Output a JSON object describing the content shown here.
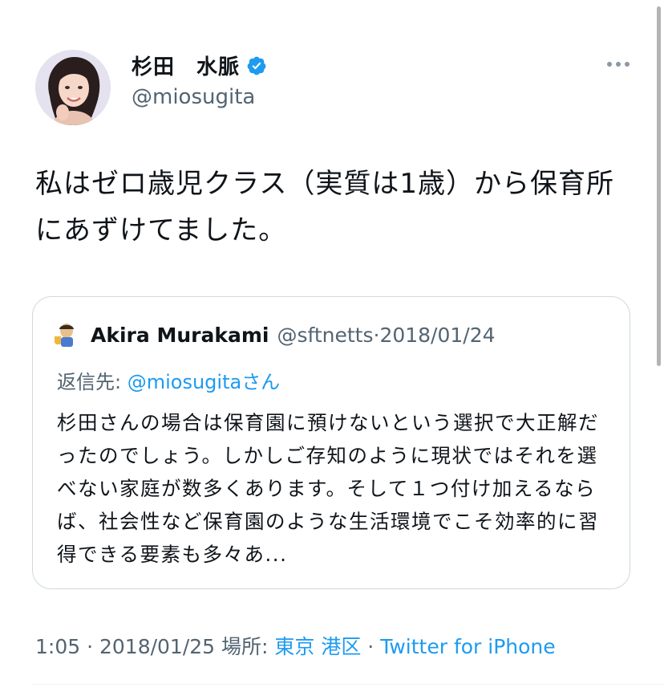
{
  "author": {
    "name": "杉田　水脈",
    "handle": "@miosugita",
    "verified": true
  },
  "tweet": {
    "text": "私はゼロ歳児クラス（実質は1歳）から保育所にあずけてました。"
  },
  "quoted_tweet": {
    "author_name": "Akira Murakami",
    "author_handle": "@sftnetts",
    "separator": " · ",
    "date": "2018/01/24",
    "reply_prefix": "返信先: ",
    "reply_handle": "@miosugita",
    "reply_suffix": "さん",
    "text": "杉田さんの場合は保育園に預けないという選択で大正解だったのでしょう。しかしご存知のように現状ではそれを選べない家庭が数多くあります。そして１つ付け加えるならば、社会性など保育園のような生活環境でこそ効率的に習得できる要素も多々あ..."
  },
  "meta": {
    "time": "1:05",
    "sep1": " · ",
    "date": "2018/01/25",
    "location_label": " 場所: ",
    "location": "東京 港区",
    "sep2": " · ",
    "source": "Twitter for iPhone"
  },
  "colors": {
    "link": "#1d9bf0",
    "secondary_text": "#536471",
    "verified_badge": "#1d9bf0"
  },
  "icons": [
    "verified-badge-icon",
    "more-options-icon"
  ]
}
